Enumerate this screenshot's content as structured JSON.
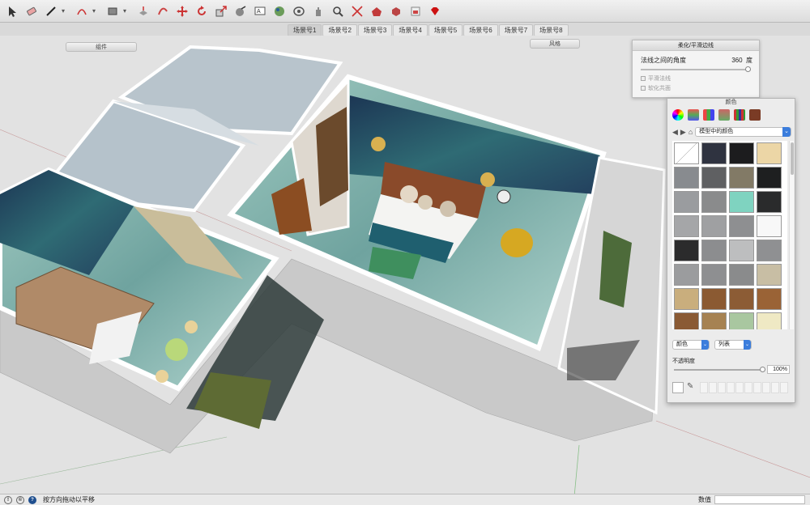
{
  "toolbar": {
    "tools": [
      {
        "icon": "select-arrow-icon"
      },
      {
        "icon": "eraser-icon"
      },
      {
        "icon": "pencil-line-icon",
        "dropdown": true
      },
      {
        "icon": "arc-icon",
        "dropdown": true
      },
      {
        "icon": "rectangle-icon",
        "dropdown": true
      },
      {
        "icon": "push-pull-icon"
      },
      {
        "icon": "follow-me-icon"
      },
      {
        "icon": "move-icon"
      },
      {
        "icon": "rotate-icon"
      },
      {
        "icon": "scale-icon"
      },
      {
        "icon": "tape-measure-icon"
      },
      {
        "icon": "text-icon"
      },
      {
        "icon": "paint-bucket-icon"
      },
      {
        "icon": "orbit-icon"
      },
      {
        "icon": "pan-hand-icon"
      },
      {
        "icon": "zoom-icon"
      },
      {
        "icon": "zoom-extents-icon"
      },
      {
        "icon": "warehouse-icon"
      },
      {
        "icon": "extension-icon"
      },
      {
        "icon": "layout-icon"
      },
      {
        "icon": "ruby-icon"
      }
    ]
  },
  "scenes": [
    "场景号1",
    "场景号2",
    "场景号3",
    "场景号4",
    "场景号5",
    "场景号6",
    "场景号7",
    "场景号8"
  ],
  "trays": {
    "components": "组件",
    "styles": "风格"
  },
  "soften_panel": {
    "title": "柔化/平滑边线",
    "angle_label": "法线之间的角度",
    "angle_value": "360",
    "angle_unit": "度",
    "option1": "平滑法线",
    "option2": "软化共面"
  },
  "colors_panel": {
    "title": "颜色",
    "library": "模型中的颜色",
    "mode": "颜色",
    "view": "列表",
    "opacity_label": "不透明度",
    "opacity_value": "100%",
    "swatches": [
      "#f4f4f4",
      "#2f3340",
      "#1c1c1e",
      "#ecd6a6",
      "#888b8f",
      "#5f6062",
      "#827a66",
      "#1e1f20",
      "#9a9c9f",
      "#8a8b8c",
      "#7fd3c0",
      "#2a2b2c",
      "#a5a6a8",
      "#9fa0a2",
      "#8e8f91",
      "#f8f8f8",
      "#2b2b2c",
      "#8c8d8f",
      "#bdbebf",
      "#8f9092",
      "#9b9c9e",
      "#8e8f91",
      "#8a8b8c",
      "#c8bea4",
      "#c9ae7d",
      "#8b5a32",
      "#8c5c35",
      "#9a6336",
      "#8a5a34",
      "#a68252",
      "#a9c7a0",
      "#efe9c4"
    ]
  },
  "status": {
    "message": "按方向拖动以平移",
    "value_label": "数值"
  }
}
